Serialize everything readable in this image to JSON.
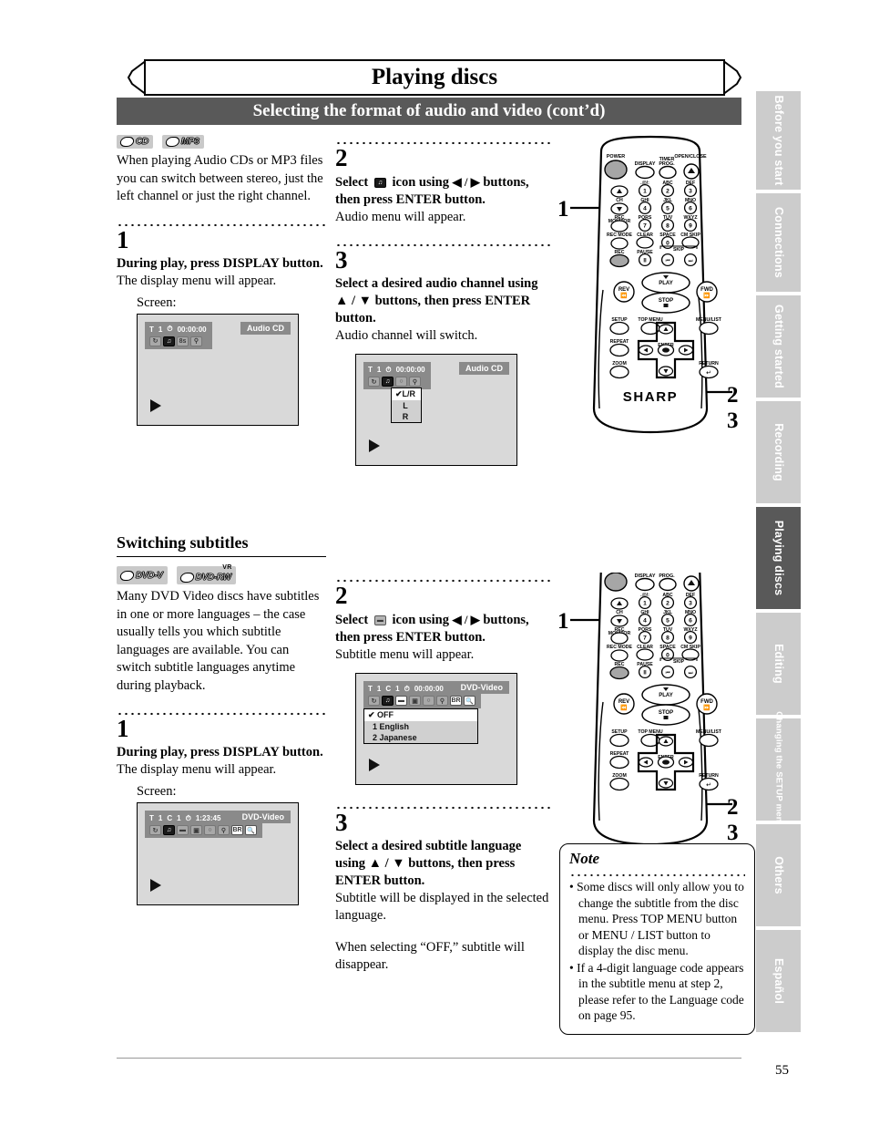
{
  "document": {
    "chapter_title": "Playing discs",
    "section_title": "Selecting the format of audio and video (cont’d)",
    "page_number": "55"
  },
  "side_tabs": [
    {
      "label": "Before you start",
      "active": false
    },
    {
      "label": "Connections",
      "active": false
    },
    {
      "label": "Getting started",
      "active": false
    },
    {
      "label": "Recording",
      "active": false
    },
    {
      "label": "Playing discs",
      "active": true
    },
    {
      "label": "Editing",
      "active": false
    },
    {
      "label": "Changing the SETUP menu",
      "active": false
    },
    {
      "label": "Others",
      "active": false
    },
    {
      "label": "Español",
      "active": false
    }
  ],
  "audio_section": {
    "disc_badges": [
      {
        "name": "CD",
        "label": "CD",
        "vr": ""
      },
      {
        "name": "MP3",
        "label": "MP3",
        "vr": ""
      }
    ],
    "intro": "When playing Audio CDs or MP3 files you can switch between stereo, just the left channel or just the right channel.",
    "step1": {
      "number": "1",
      "bold": "During play, press DISPLAY button.",
      "plain": "The display menu will appear.",
      "screen_label": "Screen:"
    },
    "step2": {
      "number": "2",
      "bold_pre": "Select",
      "icon_name": "audio-icon",
      "bold_mid": "icon using",
      "arrows": "◀ / ▶",
      "bold_post": "buttons, then press ENTER button.",
      "plain": "Audio menu will appear."
    },
    "step3": {
      "number": "3",
      "bold": "Select a desired audio channel using ▲ / ▼ buttons, then press ENTER button.",
      "plain": "Audio channel will switch."
    },
    "screen1": {
      "title_flag": "T",
      "title_num": "1",
      "time": "00:00:00",
      "disc_badge": "Audio CD",
      "icons": [
        "repeat-icon",
        "audio-icon",
        "marker-icon",
        "search-icon"
      ]
    },
    "screen2": {
      "title_flag": "T",
      "title_num": "1",
      "time": "00:00:00",
      "disc_badge": "Audio CD",
      "icons": [
        "repeat-icon",
        "audio-icon",
        "marker-icon",
        "search-icon"
      ],
      "menu_options": [
        {
          "label": "L/R",
          "checked": true
        },
        {
          "label": "L",
          "checked": false
        },
        {
          "label": "R",
          "checked": false
        }
      ]
    }
  },
  "subtitle_section": {
    "heading": "Switching subtitles",
    "disc_badges": [
      {
        "name": "DVD-V",
        "label": "DVD-V",
        "vr": ""
      },
      {
        "name": "DVD-RW-VR",
        "label": "DVD-RW",
        "vr": "VR"
      }
    ],
    "intro": "Many DVD Video discs have subtitles in one or more languages – the case usually tells you which subtitle languages are available. You can switch subtitle languages anytime during playback.",
    "step1": {
      "number": "1",
      "bold": "During play, press DISPLAY button.",
      "plain": "The display menu will appear.",
      "screen_label": "Screen:"
    },
    "step2": {
      "number": "2",
      "bold_pre": "Select",
      "icon_name": "subtitle-icon",
      "bold_mid": "icon using",
      "arrows": "◀ / ▶",
      "bold_post": "buttons, then press ENTER button.",
      "plain": "Subtitle menu will appear."
    },
    "step3": {
      "number": "3",
      "bold": "Select a desired subtitle language using ▲ / ▼ buttons, then press ENTER button.",
      "plain": "Subtitle will be displayed in the selected language.",
      "plain2": "When selecting “OFF,” subtitle will disappear."
    },
    "screen1": {
      "title_flag": "T",
      "title_num": "1",
      "chapter_flag": "C",
      "chapter_num": "1",
      "time": "1:23:45",
      "disc_badge": "DVD-Video",
      "icons": [
        "repeat-icon",
        "audio-icon",
        "subtitle-icon",
        "angle-icon",
        "marker-icon",
        "search-icon",
        "bitrate-icon",
        "zoom-icon"
      ]
    },
    "screen2": {
      "title_flag": "T",
      "title_num": "1",
      "chapter_flag": "C",
      "chapter_num": "1",
      "time": "00:00:00",
      "disc_badge": "DVD-Video",
      "icons": [
        "repeat-icon",
        "audio-icon",
        "subtitle-icon",
        "angle-icon",
        "marker-icon",
        "search-icon",
        "bitrate-icon",
        "zoom-icon"
      ],
      "menu_options": [
        {
          "label": "OFF",
          "checked": true,
          "num": ""
        },
        {
          "label": "English",
          "checked": false,
          "num": "1"
        },
        {
          "label": "Japanese",
          "checked": false,
          "num": "2"
        }
      ]
    }
  },
  "remote": {
    "brand": "SHARP",
    "callouts": {
      "one": "1",
      "two": "2",
      "three": "3"
    },
    "buttons": {
      "power": "POWER",
      "display": "DISPLAY",
      "timer_prog": "TIMER PROG.",
      "open_close": "OPEN/CLOSE",
      "ch": "CH",
      "rec_monitor": "REC MONITOR",
      "rec_mode": "REC MODE",
      "clear": "CLEAR",
      "space": "SPACE",
      "cm_skip": "CM SKIP",
      "rec": "REC",
      "pause": "PAUSE",
      "skip": "SKIP",
      "rev": "REV",
      "fwd": "FWD",
      "play": "PLAY",
      "stop": "STOP",
      "setup": "SETUP",
      "top_menu": "TOP MENU",
      "menu_list": "MENU/LIST",
      "repeat": "REPEAT",
      "enter": "ENTER",
      "zoom": "ZOOM",
      "return": "RETURN"
    },
    "keypad": [
      {
        "letters": ".@/:",
        "digit": "1"
      },
      {
        "letters": "ABC",
        "digit": "2"
      },
      {
        "letters": "DEF",
        "digit": "3"
      },
      {
        "letters": "GHI",
        "digit": "4"
      },
      {
        "letters": "JKL",
        "digit": "5"
      },
      {
        "letters": "MNO",
        "digit": "6"
      },
      {
        "letters": "PQRS",
        "digit": "7"
      },
      {
        "letters": "TUV",
        "digit": "8"
      },
      {
        "letters": "WXYZ",
        "digit": "9"
      },
      {
        "letters": "",
        "digit": "0"
      }
    ]
  },
  "note": {
    "title": "Note",
    "items": [
      "Some discs will only allow you to change the subtitle from the disc menu. Press TOP MENU button or MENU / LIST button to display the disc menu.",
      "If a 4-digit language code appears in the subtitle menu at step 2, please refer to the Language code on page 95."
    ]
  }
}
